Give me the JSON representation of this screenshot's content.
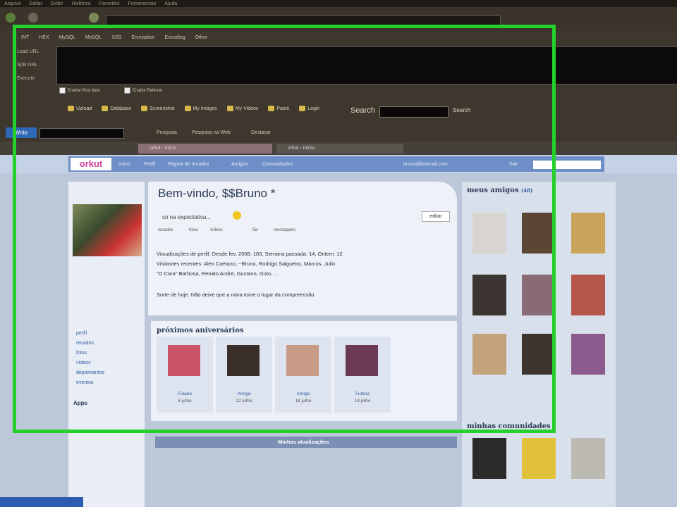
{
  "browser": {
    "menu": [
      "Arquivo",
      "Editar",
      "Exibir",
      "Histórico",
      "Favoritos",
      "Ferramentas",
      "Ajuda"
    ],
    "hackbar_menu": [
      "INT",
      "HEX",
      "MySQL",
      "MsSQL",
      "XSS",
      "Encryption",
      "Encoding",
      "Other"
    ],
    "side_labels": [
      "Load URL",
      "Split URL",
      "Execute"
    ],
    "enable_post": "Enable Post data",
    "enable_referrer": "Enable Referrer",
    "toolbar_items": [
      "Upload",
      "Database",
      "Screenshot",
      "My Images",
      "My Videos",
      "Paste",
      "Login"
    ],
    "search_label": "Search",
    "search_go": "Search",
    "bm_button": "Write",
    "bm_items": [
      "Pesquisa",
      "Pesquisa na Web",
      "Destacar"
    ],
    "tabs": [
      "orkut - início",
      "orkut - inicio"
    ]
  },
  "orkut": {
    "logo": "orkut",
    "nav": [
      "Início",
      "Perfil",
      "Página de recados",
      "Amigos",
      "Comunidades"
    ],
    "user_email": "bruno@hotmail.com",
    "sair": "Sair",
    "welcome": "Bem-vindo, $$Bruno *",
    "status": "só na expectativa... ",
    "edit": "editar",
    "stats": [
      "recados",
      "fotos",
      "vídeos",
      "fãs",
      "mensagens"
    ],
    "info": [
      "Visualizações de perfil: Desde fev. 2006: 183, Semana passada: 14, Ontem: 12",
      "Visitantes recentes: Alex Caetano, ~Bruno, Rodrigo Salgueiro, Marcos, Julio",
      "\"O Cara\" Barbosa, Renato Andre, Gustavo, Guto, ...",
      "Sorte de hoje: Não deixe que a raiva tome o lugar da compreensão."
    ],
    "birthdays_title": "próximos aniversários",
    "birthdays": [
      {
        "name": "Fulano",
        "date": "8 julho"
      },
      {
        "name": "Amiga",
        "date": "12 julho"
      },
      {
        "name": "Amiga",
        "date": "18 julho"
      },
      {
        "name": "Fulana",
        "date": "18 julho"
      }
    ],
    "updates_tab": "Minhas atualizações",
    "friends_title": "meus amigos",
    "friends_count": "(48)",
    "communities_title": "minhas comunidades",
    "sidebar_links": [
      "perfil",
      "recados",
      "fotos",
      "vídeos",
      "depoimentos",
      "eventos"
    ],
    "apps_title": "Apps"
  }
}
